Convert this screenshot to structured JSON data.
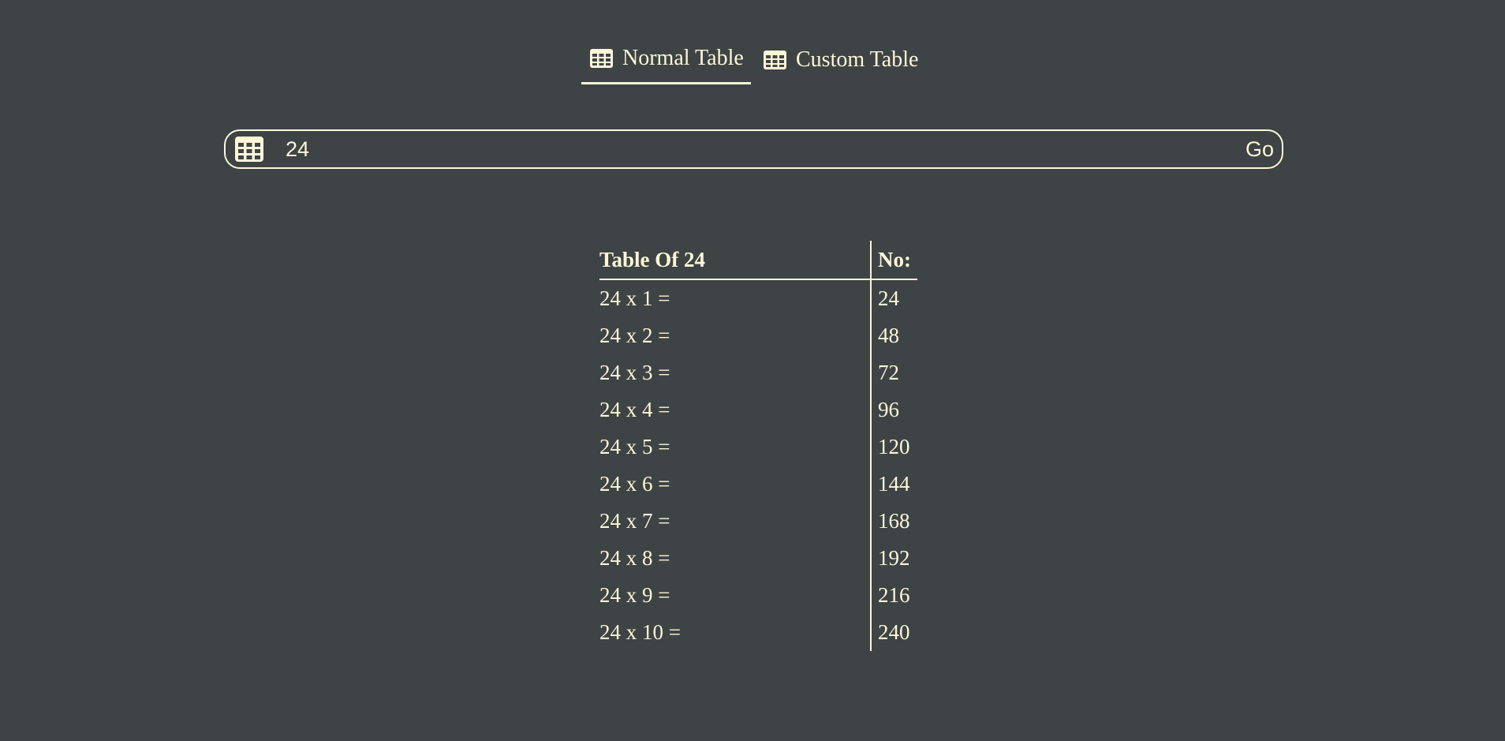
{
  "tabs": [
    {
      "label": "Normal Table",
      "icon": "table-icon",
      "active": true
    },
    {
      "label": "Custom Table",
      "icon": "table-icon",
      "active": false
    }
  ],
  "search": {
    "icon": "table-icon",
    "value": "24",
    "go_label": "Go"
  },
  "table": {
    "header_expr": "Table Of 24",
    "header_val": "No:",
    "rows": [
      {
        "expr": "24 x 1 =",
        "val": "24"
      },
      {
        "expr": "24 x 2 =",
        "val": "48"
      },
      {
        "expr": "24 x 3 =",
        "val": "72"
      },
      {
        "expr": "24 x 4 =",
        "val": "96"
      },
      {
        "expr": "24 x 5 =",
        "val": "120"
      },
      {
        "expr": "24 x 6 =",
        "val": "144"
      },
      {
        "expr": "24 x 7 =",
        "val": "168"
      },
      {
        "expr": "24 x 8 =",
        "val": "192"
      },
      {
        "expr": "24 x 9 =",
        "val": "216"
      },
      {
        "expr": "24 x 10 =",
        "val": "240"
      }
    ]
  },
  "colors": {
    "background": "#3e4445",
    "foreground": "#fdf6d8"
  }
}
